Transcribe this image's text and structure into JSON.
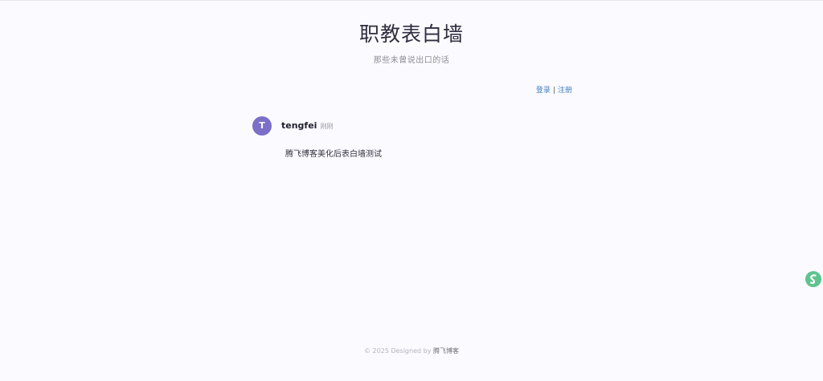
{
  "header": {
    "title": "职教表白墙",
    "subtitle": "那些未曾说出口的话"
  },
  "auth": {
    "login": "登录",
    "separator": "|",
    "register": "注册"
  },
  "posts": [
    {
      "avatar_letter": "T",
      "author": "tengfei",
      "time": "刚刚",
      "content": "腾飞博客美化后表白墙测试"
    }
  ],
  "footer": {
    "text": "© 2025 Designed by",
    "brand": "腾飞博客"
  },
  "colors": {
    "background": "#fbfaff",
    "avatar": "#7b6fc8",
    "link": "#3f7fbf",
    "widget": "#5ec48f"
  },
  "icons": {
    "floating_widget": "chat-bubble-icon"
  }
}
